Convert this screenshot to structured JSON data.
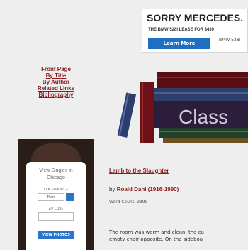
{
  "ad": {
    "title": "SORRY MERCEDES.",
    "subtitle": "THE BMW 528i LEASE FOR $439",
    "button_label": "Learn More",
    "logo_text": "BMW 528i"
  },
  "nav": {
    "links": [
      "Front Page",
      "By Title",
      "By Author",
      "Related Links",
      "Bibliography"
    ]
  },
  "books_graphic": {
    "text": "Class"
  },
  "singles_widget": {
    "title_line1": "View Singles in",
    "title_line2": "Chicago",
    "label_seeking": "I AM SEEKING A",
    "select_value": "Man",
    "label_zip": "ZIP CODE",
    "button_label": "VIEW PHOTOS"
  },
  "story": {
    "title": "Lamb to the Slaughter",
    "by_prefix": "by",
    "author": "Roald Dahl (1916-1990)",
    "word_count": "Word Count: 3899",
    "text_line1": "The room was warm and clean, the cu",
    "text_line2": "empty chair opposite. On the sideboa"
  },
  "colors": {
    "link": "#8b1a1a",
    "accent_blue": "#1e6fc1",
    "background": "#eeeeee"
  }
}
